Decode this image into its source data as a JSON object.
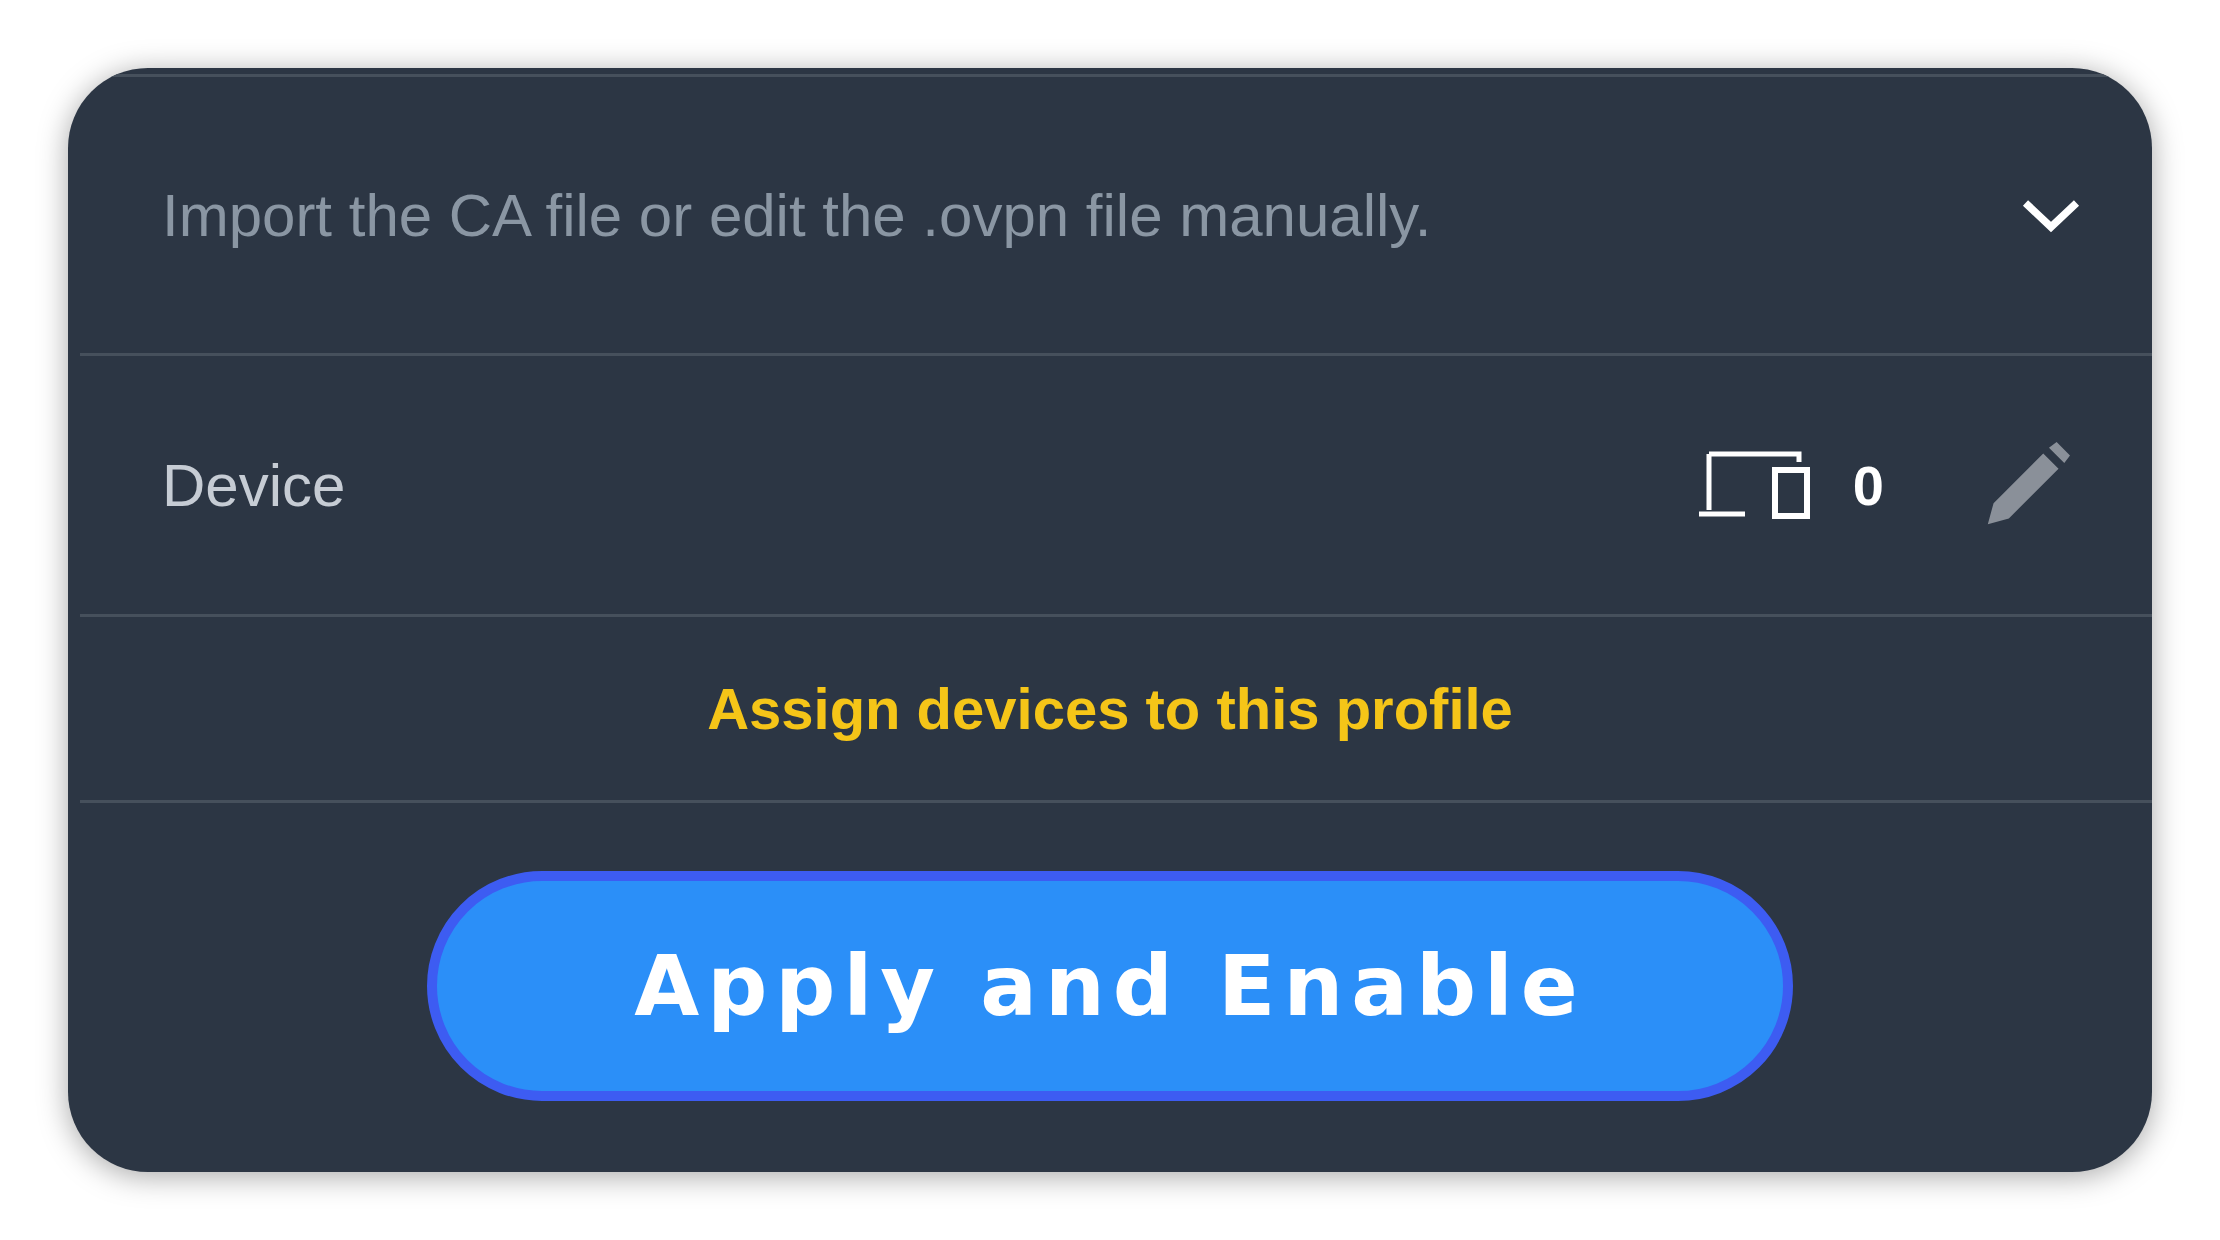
{
  "ca_row": {
    "text": "Import the CA file or edit the .ovpn file manually.",
    "expanded": false
  },
  "device_row": {
    "label": "Device",
    "count": "0"
  },
  "assign_link": "Assign devices to this profile",
  "apply_button": "Apply and Enable"
}
